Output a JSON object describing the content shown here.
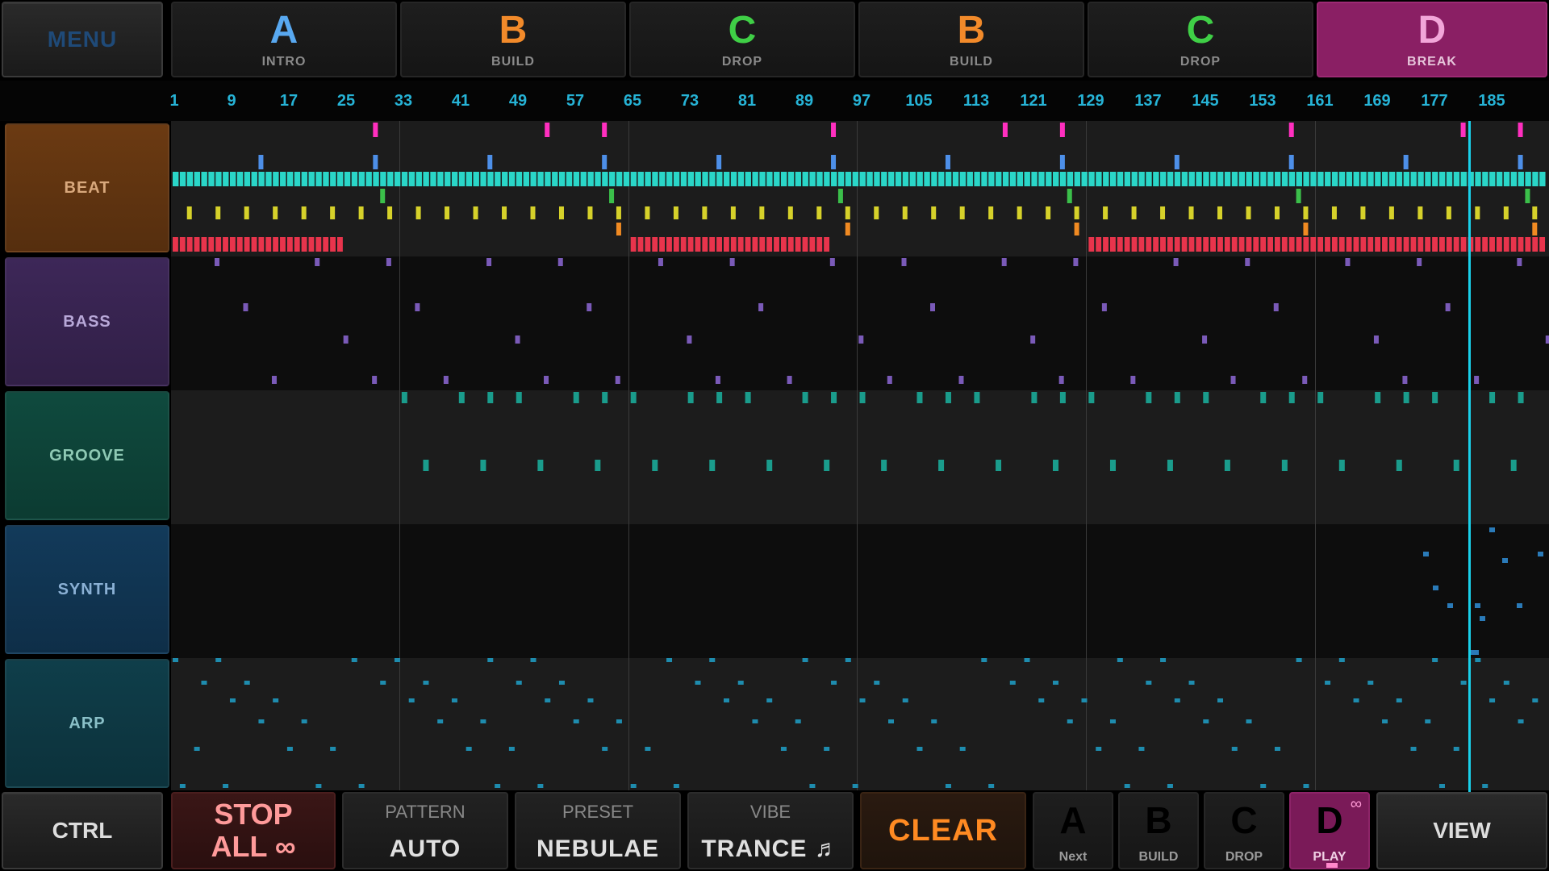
{
  "menu_label": "MENU",
  "sections": [
    {
      "letter": "A",
      "name": "INTRO",
      "color": "#58a8f0"
    },
    {
      "letter": "B",
      "name": "BUILD",
      "color": "#f28a2a"
    },
    {
      "letter": "C",
      "name": "DROP",
      "color": "#3fcf46"
    },
    {
      "letter": "B",
      "name": "BUILD",
      "color": "#f28a2a"
    },
    {
      "letter": "C",
      "name": "DROP",
      "color": "#3fcf46"
    },
    {
      "letter": "D",
      "name": "BREAK",
      "color": "#f2a6d9"
    }
  ],
  "ruler": [
    "1",
    "9",
    "17",
    "25",
    "33",
    "41",
    "49",
    "57",
    "65",
    "73",
    "81",
    "89",
    "97",
    "105",
    "113",
    "121",
    "129",
    "137",
    "145",
    "153",
    "161",
    "169",
    "177",
    "185"
  ],
  "tracks": [
    {
      "name": "BEAT",
      "color": "#6b3a12",
      "text": "#d8a87c"
    },
    {
      "name": "BASS",
      "color": "#3d2758",
      "text": "#b8a8d8"
    },
    {
      "name": "GROOVE",
      "color": "#0f4a3e",
      "text": "#8ec9b4"
    },
    {
      "name": "SYNTH",
      "color": "#123a5a",
      "text": "#8ab0d4"
    },
    {
      "name": "ARP",
      "color": "#0f3e4a",
      "text": "#8ac0c8"
    }
  ],
  "bottom": {
    "ctrl": "CTRL",
    "stop_line1": "STOP",
    "stop_line2": "ALL ∞",
    "pattern_caption": "PATTERN",
    "pattern_value": "AUTO",
    "preset_caption": "PRESET",
    "preset_value": "NEBULAE",
    "vibe_caption": "VIBE",
    "vibe_value": "TRANCE ♬",
    "clear": "CLEAR",
    "view": "VIEW",
    "queue": [
      {
        "letter": "A",
        "label": "Next",
        "color": "#58a8f0"
      },
      {
        "letter": "B",
        "label": "BUILD",
        "color": "#f28a2a"
      },
      {
        "letter": "C",
        "label": "DROP",
        "color": "#3fcf46"
      },
      {
        "letter": "D",
        "label": "PLAY",
        "color": "#f2a6d9"
      }
    ]
  },
  "colors": {
    "beat_pink": "#ff2fbf",
    "beat_blue": "#4d8fe8",
    "beat_cyan": "#2ad6c8",
    "beat_green": "#3bbf4a",
    "beat_yellow": "#d6d12a",
    "beat_orange": "#f08a22",
    "beat_red": "#e8344c",
    "bass_purple": "#7a5ab8",
    "groove_teal": "#1a9c8c",
    "synth_blue": "#2a7ab8",
    "arp_teal": "#1e8cae",
    "playhead": "#19d0ea"
  }
}
